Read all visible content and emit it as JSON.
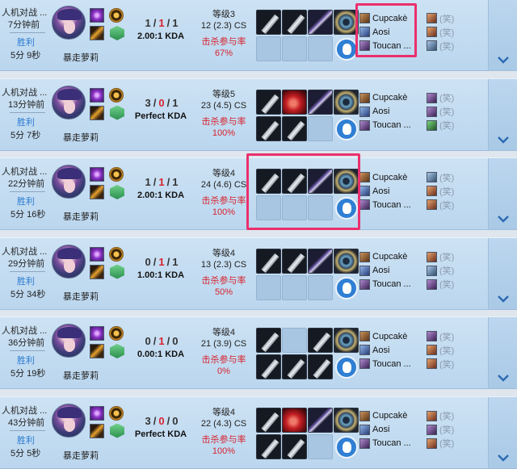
{
  "matches": [
    {
      "mode": "人机对战 ...",
      "time_ago": "7分钟前",
      "result": "胜利",
      "duration": "5分 9秒",
      "champion": "暴走萝莉",
      "kda": {
        "k": "1",
        "d": "1",
        "sep": "/",
        "a": "1"
      },
      "kda_text": "2.00:1 KDA",
      "level": "等级3",
      "cs": "12 (2.3) CS",
      "kp_label": "击杀参与率",
      "kp": "67%",
      "items_top": [
        "blade",
        "blade",
        "sword",
        "eye"
      ],
      "items_bottom": [
        "empty",
        "empty",
        "empty"
      ],
      "team": [
        {
          "name": "Cupcakè",
          "icon": "c0"
        },
        {
          "name": "Aosi",
          "icon": "c1"
        },
        {
          "name": "Toucan ...",
          "icon": "c2"
        }
      ],
      "enemies": [
        {
          "name": "(笑)",
          "icon": "c3"
        },
        {
          "name": "(笑)",
          "icon": "c3"
        },
        {
          "name": "(笑)",
          "icon": "c6"
        }
      ]
    },
    {
      "mode": "人机对战 ...",
      "time_ago": "13分钟前",
      "result": "胜利",
      "duration": "5分 7秒",
      "champion": "暴走萝莉",
      "kda": {
        "k": "3",
        "d": "0",
        "sep": "/",
        "a": "1"
      },
      "kda_text": "Perfect KDA",
      "level": "等级5",
      "cs": "23 (4.5) CS",
      "kp_label": "击杀参与率",
      "kp": "100%",
      "items_top": [
        "blade",
        "mask",
        "sword",
        "eye"
      ],
      "items_bottom": [
        "blade",
        "blade",
        "empty"
      ],
      "team": [
        {
          "name": "Cupcakè",
          "icon": "c0"
        },
        {
          "name": "Aosi",
          "icon": "c1"
        },
        {
          "name": "Toucan ...",
          "icon": "c2"
        }
      ],
      "enemies": [
        {
          "name": "(笑)",
          "icon": "c2"
        },
        {
          "name": "(笑)",
          "icon": "c2"
        },
        {
          "name": "(笑)",
          "icon": "c5"
        }
      ]
    },
    {
      "mode": "人机对战 ...",
      "time_ago": "22分钟前",
      "result": "胜利",
      "duration": "5分 16秒",
      "champion": "暴走萝莉",
      "kda": {
        "k": "1",
        "d": "1",
        "sep": "/",
        "a": "1"
      },
      "kda_text": "2.00:1 KDA",
      "level": "等级4",
      "cs": "24 (4.6) CS",
      "kp_label": "击杀参与率",
      "kp": "100%",
      "items_top": [
        "blade",
        "blade",
        "sword",
        "eye"
      ],
      "items_bottom": [
        "empty",
        "empty",
        "empty"
      ],
      "team": [
        {
          "name": "Cupcakè",
          "icon": "c0"
        },
        {
          "name": "Aosi",
          "icon": "c1"
        },
        {
          "name": "Toucan ...",
          "icon": "c2"
        }
      ],
      "enemies": [
        {
          "name": "(笑)",
          "icon": "c6"
        },
        {
          "name": "(笑)",
          "icon": "c3"
        },
        {
          "name": "(笑)",
          "icon": "c3"
        }
      ]
    },
    {
      "mode": "人机对战 ...",
      "time_ago": "29分钟前",
      "result": "胜利",
      "duration": "5分 34秒",
      "champion": "暴走萝莉",
      "kda": {
        "k": "0",
        "d": "1",
        "sep": "/",
        "a": "1"
      },
      "kda_text": "1.00:1 KDA",
      "level": "等级4",
      "cs": "13 (2.3) CS",
      "kp_label": "击杀参与率",
      "kp": "50%",
      "items_top": [
        "blade",
        "blade",
        "sword",
        "eye"
      ],
      "items_bottom": [
        "empty",
        "empty",
        "empty"
      ],
      "team": [
        {
          "name": "Cupcakè",
          "icon": "c0"
        },
        {
          "name": "Aosi",
          "icon": "c1"
        },
        {
          "name": "Toucan ...",
          "icon": "c2"
        }
      ],
      "enemies": [
        {
          "name": "(笑)",
          "icon": "c3"
        },
        {
          "name": "(笑)",
          "icon": "c6"
        },
        {
          "name": "(笑)",
          "icon": "c2"
        }
      ]
    },
    {
      "mode": "人机对战 ...",
      "time_ago": "36分钟前",
      "result": "胜利",
      "duration": "5分 19秒",
      "champion": "暴走萝莉",
      "kda": {
        "k": "0",
        "d": "1",
        "sep": "/",
        "a": "0"
      },
      "kda_text": "0.00:1 KDA",
      "level": "等级4",
      "cs": "21 (3.9) CS",
      "kp_label": "击杀参与率",
      "kp": "0%",
      "items_top": [
        "blade",
        "empty",
        "blade",
        "eye"
      ],
      "items_bottom": [
        "blade",
        "blade",
        "blade"
      ],
      "team": [
        {
          "name": "Cupcakè",
          "icon": "c0"
        },
        {
          "name": "Aosi",
          "icon": "c1"
        },
        {
          "name": "Toucan ...",
          "icon": "c2"
        }
      ],
      "enemies": [
        {
          "name": "(笑)",
          "icon": "c2"
        },
        {
          "name": "(笑)",
          "icon": "c3"
        },
        {
          "name": "(笑)",
          "icon": "c3"
        }
      ]
    },
    {
      "mode": "人机对战 ...",
      "time_ago": "43分钟前",
      "result": "胜利",
      "duration": "5分 5秒",
      "champion": "暴走萝莉",
      "kda": {
        "k": "3",
        "d": "0",
        "sep": "/",
        "a": "0"
      },
      "kda_text": "Perfect KDA",
      "level": "等级4",
      "cs": "22 (4.3) CS",
      "kp_label": "击杀参与率",
      "kp": "100%",
      "items_top": [
        "blade",
        "mask",
        "sword",
        "eye"
      ],
      "items_bottom": [
        "blade",
        "blade",
        "empty"
      ],
      "team": [
        {
          "name": "Cupcakè",
          "icon": "c0"
        },
        {
          "name": "Aosi",
          "icon": "c1"
        },
        {
          "name": "Toucan ...",
          "icon": "c2"
        }
      ],
      "enemies": [
        {
          "name": "(笑)",
          "icon": "c3"
        },
        {
          "name": "(笑)",
          "icon": "c2"
        },
        {
          "name": "(笑)",
          "icon": "c3"
        }
      ]
    }
  ],
  "highlight_color": "#ea2f6d",
  "expand_icon": "chevron-down-icon"
}
